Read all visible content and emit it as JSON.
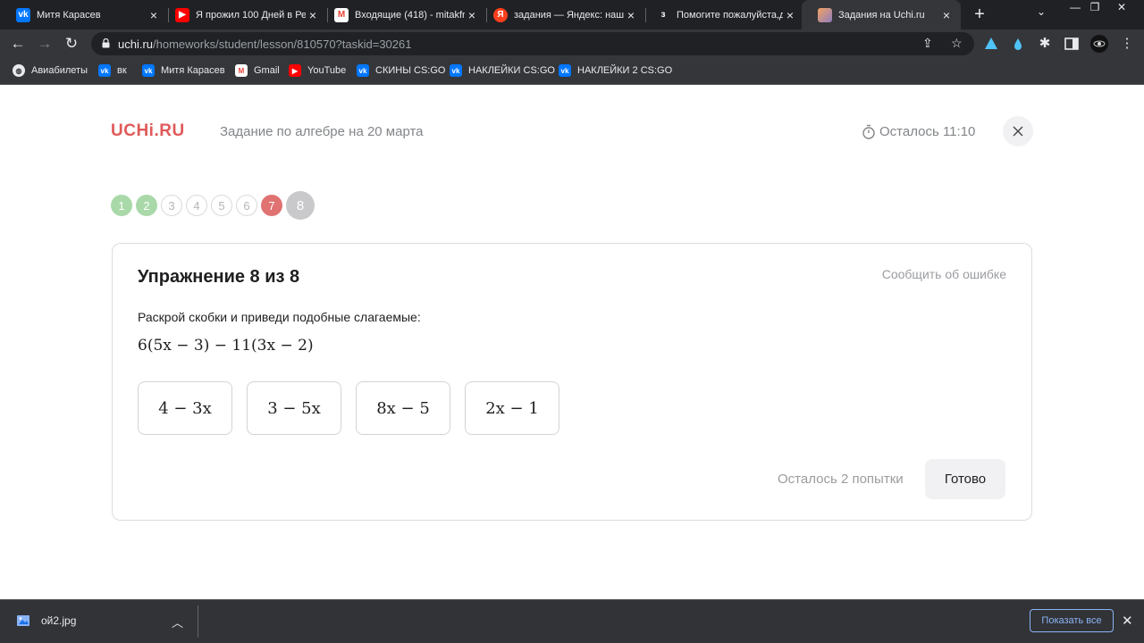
{
  "browser": {
    "tabs": [
      {
        "title": "Митя Карасев",
        "icon": "vk-icon",
        "color": "#0077ff"
      },
      {
        "title": "Я прожил 100 Дней в Ре",
        "icon": "youtube-icon",
        "color": "#ff0000"
      },
      {
        "title": "Входящие (418) - mitakfr",
        "icon": "gmail-icon",
        "color": "#ea4335"
      },
      {
        "title": "задания — Яндекс: наш",
        "icon": "yandex-icon",
        "color": "#fc3f1d"
      },
      {
        "title": "Помогите пожалуйста,да",
        "icon": "znanija-icon",
        "color": "#202124"
      },
      {
        "title": "Задания на Uchi.ru",
        "icon": "uchi-icon",
        "color": "#f4a261"
      }
    ],
    "new_tab": "+",
    "url_host": "uchi.ru",
    "url_path": "/homeworks/student/lesson/810570?taskid=30261",
    "bookmarks": [
      {
        "label": "Авиабилеты",
        "icon": "globe-icon",
        "color": "#5f6368"
      },
      {
        "label": "вк",
        "icon": "vk-icon",
        "color": "#0077ff"
      },
      {
        "label": "Митя Карасев",
        "icon": "vk-icon",
        "color": "#0077ff"
      },
      {
        "label": "Gmail",
        "icon": "gmail-icon",
        "color": "#ea4335"
      },
      {
        "label": "YouTube",
        "icon": "youtube-icon",
        "color": "#ff0000"
      },
      {
        "label": "СКИНЫ CS:GO",
        "icon": "vk-icon",
        "color": "#0077ff"
      },
      {
        "label": "НАКЛЕЙКИ CS:GO",
        "icon": "vk-icon",
        "color": "#0077ff"
      },
      {
        "label": "НАКЛЕЙКИ 2 CS:GO",
        "icon": "vk-icon",
        "color": "#0077ff"
      }
    ]
  },
  "page": {
    "logo": "UCHi.RU",
    "lesson_title": "Задание по алгебре на 20 марта",
    "timer_label": "Осталось 11:10",
    "steps": [
      {
        "label": "1",
        "state": "correct"
      },
      {
        "label": "2",
        "state": "correct"
      },
      {
        "label": "3",
        "state": "pending"
      },
      {
        "label": "4",
        "state": "pending"
      },
      {
        "label": "5",
        "state": "pending"
      },
      {
        "label": "6",
        "state": "pending"
      },
      {
        "label": "7",
        "state": "wrong"
      },
      {
        "label": "8",
        "state": "current"
      }
    ],
    "exercise": {
      "title": "Упражнение 8 из 8",
      "report_label": "Сообщить об ошибке",
      "instruction": "Раскрой скобки и приведи подобные слагаемые:",
      "expression": "6(5x − 3) − 11(3x − 2)",
      "options": [
        "4 − 3x",
        "3 − 5x",
        "8x − 5",
        "2x − 1"
      ],
      "attempts_label": "Осталось 2 попытки",
      "done_label": "Готово"
    }
  },
  "downloads": {
    "file_name": "ой2.jpg",
    "show_all_label": "Показать все"
  },
  "colors": {
    "accent": "#e05a5a",
    "correct": "#a9d9a9",
    "wrong": "#e07272",
    "current": "#c9c9cc"
  }
}
